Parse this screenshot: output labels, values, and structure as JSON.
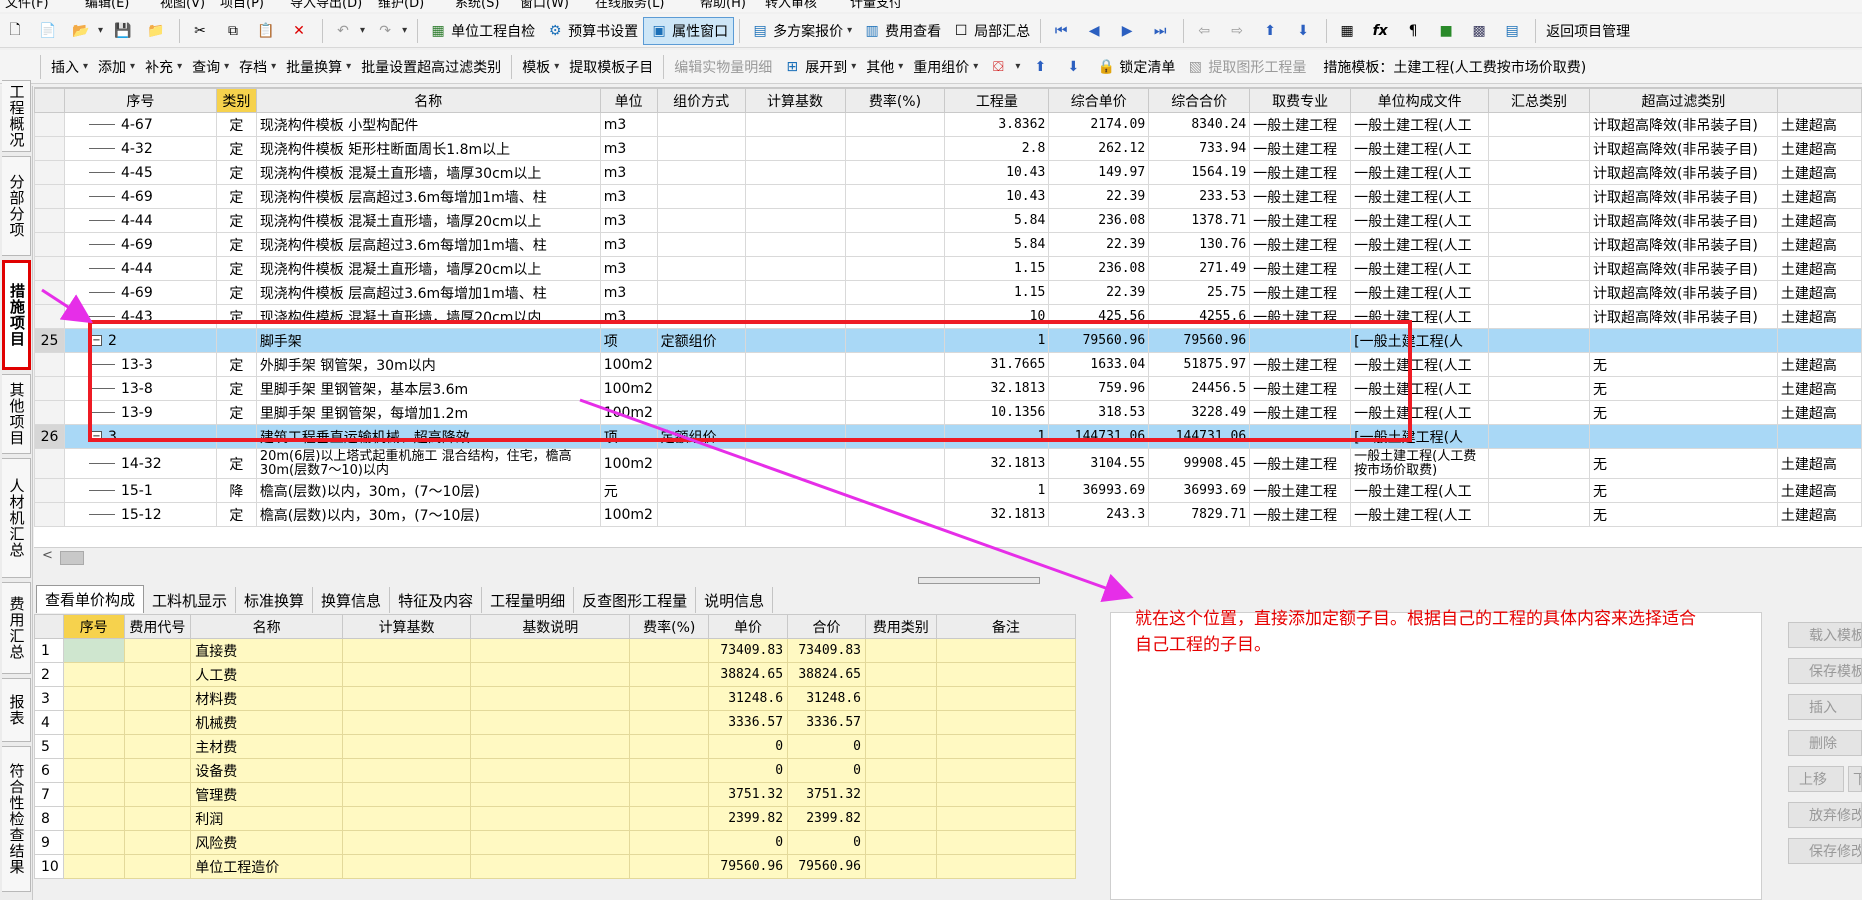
{
  "menu": {
    "items": [
      "文件(F)",
      "编辑(E)",
      "视图(V)",
      "项目(P)",
      "导入导出(D)",
      "维护(D)",
      "系统(S)",
      "窗口(W)",
      "在线服务(L)",
      "帮助(H)",
      "转入审核",
      "计量支付"
    ]
  },
  "toolbar1": {
    "unit_check": "单位工程自检",
    "budget_settings": "预算书设置",
    "property_window": "属性窗口",
    "multi_quote": "多方案报价",
    "fee_view": "费用查看",
    "partial_summary": "局部汇总",
    "return_project": "返回项目管理"
  },
  "toolbar2": {
    "insert": "插入",
    "add": "添加",
    "supplement": "补充",
    "query": "查询",
    "save_file": "存档",
    "batch_convert": "批量换算",
    "batch_filter": "批量设置超高过滤类别",
    "template": "模板",
    "extract_template": "提取模板子目",
    "edit_quantity": "编辑实物量明细",
    "expand": "展开到",
    "other": "其他",
    "reuse": "重用组价",
    "lock": "锁定清单",
    "extract_graphic": "提取图形工程量",
    "template_label": "措施模板：土建工程(人工费按市场价取费)"
  },
  "left_tabs": [
    "工程概况",
    "分部分项",
    "措施项目",
    "其他项目",
    "人材机汇总",
    "费用汇总",
    "报表",
    "符合性检查结果"
  ],
  "main_table": {
    "headers": [
      "",
      "序号",
      "类别",
      "名称",
      "单位",
      "组价方式",
      "计算基数",
      "费率(%)",
      "工程量",
      "综合单价",
      "综合合价",
      "取费专业",
      "单位构成文件",
      "汇总类别",
      "超高过滤类别",
      ""
    ],
    "rows": [
      {
        "rn": "",
        "code": "4-67",
        "type": "定",
        "name": "现浇构件模板 小型构配件",
        "unit": "m3",
        "method": "",
        "base": "",
        "rate": "",
        "qty": "3.8362",
        "price": "2174.09",
        "total": "8340.24",
        "spec": "一般土建工程",
        "file": "一般土建工程(人工",
        "sum": "",
        "filter": "计取超高降效(非吊装子目)",
        "extra": "土建超高"
      },
      {
        "rn": "",
        "code": "4-32",
        "type": "定",
        "name": "现浇构件模板 矩形柱断面周长1.8m以上",
        "unit": "m3",
        "method": "",
        "base": "",
        "rate": "",
        "qty": "2.8",
        "price": "262.12",
        "total": "733.94",
        "spec": "一般土建工程",
        "file": "一般土建工程(人工",
        "sum": "",
        "filter": "计取超高降效(非吊装子目)",
        "extra": "土建超高"
      },
      {
        "rn": "",
        "code": "4-45",
        "type": "定",
        "name": "现浇构件模板 混凝土直形墙，墙厚30cm以上",
        "unit": "m3",
        "method": "",
        "base": "",
        "rate": "",
        "qty": "10.43",
        "price": "149.97",
        "total": "1564.19",
        "spec": "一般土建工程",
        "file": "一般土建工程(人工",
        "sum": "",
        "filter": "计取超高降效(非吊装子目)",
        "extra": "土建超高"
      },
      {
        "rn": "",
        "code": "4-69",
        "type": "定",
        "name": "现浇构件模板 层高超过3.6m每增加1m墙、柱",
        "unit": "m3",
        "method": "",
        "base": "",
        "rate": "",
        "qty": "10.43",
        "price": "22.39",
        "total": "233.53",
        "spec": "一般土建工程",
        "file": "一般土建工程(人工",
        "sum": "",
        "filter": "计取超高降效(非吊装子目)",
        "extra": "土建超高"
      },
      {
        "rn": "",
        "code": "4-44",
        "type": "定",
        "name": "现浇构件模板 混凝土直形墙，墙厚20cm以上",
        "unit": "m3",
        "method": "",
        "base": "",
        "rate": "",
        "qty": "5.84",
        "price": "236.08",
        "total": "1378.71",
        "spec": "一般土建工程",
        "file": "一般土建工程(人工",
        "sum": "",
        "filter": "计取超高降效(非吊装子目)",
        "extra": "土建超高"
      },
      {
        "rn": "",
        "code": "4-69",
        "type": "定",
        "name": "现浇构件模板 层高超过3.6m每增加1m墙、柱",
        "unit": "m3",
        "method": "",
        "base": "",
        "rate": "",
        "qty": "5.84",
        "price": "22.39",
        "total": "130.76",
        "spec": "一般土建工程",
        "file": "一般土建工程(人工",
        "sum": "",
        "filter": "计取超高降效(非吊装子目)",
        "extra": "土建超高"
      },
      {
        "rn": "",
        "code": "4-44",
        "type": "定",
        "name": "现浇构件模板 混凝土直形墙，墙厚20cm以上",
        "unit": "m3",
        "method": "",
        "base": "",
        "rate": "",
        "qty": "1.15",
        "price": "236.08",
        "total": "271.49",
        "spec": "一般土建工程",
        "file": "一般土建工程(人工",
        "sum": "",
        "filter": "计取超高降效(非吊装子目)",
        "extra": "土建超高"
      },
      {
        "rn": "",
        "code": "4-69",
        "type": "定",
        "name": "现浇构件模板 层高超过3.6m每增加1m墙、柱",
        "unit": "m3",
        "method": "",
        "base": "",
        "rate": "",
        "qty": "1.15",
        "price": "22.39",
        "total": "25.75",
        "spec": "一般土建工程",
        "file": "一般土建工程(人工",
        "sum": "",
        "filter": "计取超高降效(非吊装子目)",
        "extra": "土建超高"
      },
      {
        "rn": "",
        "code": "4-43",
        "type": "定",
        "name": "现浇构件模板 混凝土直形墙，墙厚20cm以内",
        "unit": "m3",
        "method": "",
        "base": "",
        "rate": "",
        "qty": "10",
        "price": "425.56",
        "total": "4255.6",
        "spec": "一般土建工程",
        "file": "一般土建工程(人工",
        "sum": "",
        "filter": "计取超高降效(非吊装子目)",
        "extra": "土建超高"
      },
      {
        "rn": "25",
        "group": true,
        "code": "2",
        "type": "",
        "name": "脚手架",
        "unit": "项",
        "method": "定额组价",
        "base": "",
        "rate": "",
        "qty": "1",
        "price": "79560.96",
        "total": "79560.96",
        "spec": "",
        "file": "[一般土建工程(人",
        "sum": "",
        "filter": "",
        "extra": ""
      },
      {
        "rn": "",
        "code": "13-3",
        "type": "定",
        "name": "外脚手架 钢管架，30m以内",
        "unit": "100m2",
        "method": "",
        "base": "",
        "rate": "",
        "qty": "31.7665",
        "price": "1633.04",
        "total": "51875.97",
        "spec": "一般土建工程",
        "file": "一般土建工程(人工",
        "sum": "",
        "filter": "无",
        "extra": "土建超高"
      },
      {
        "rn": "",
        "code": "13-8",
        "type": "定",
        "name": "里脚手架 里钢管架，基本层3.6m",
        "unit": "100m2",
        "method": "",
        "base": "",
        "rate": "",
        "qty": "32.1813",
        "price": "759.96",
        "total": "24456.5",
        "spec": "一般土建工程",
        "file": "一般土建工程(人工",
        "sum": "",
        "filter": "无",
        "extra": "土建超高"
      },
      {
        "rn": "",
        "code": "13-9",
        "type": "定",
        "name": "里脚手架 里钢管架，每增加1.2m",
        "unit": "100m2",
        "method": "",
        "base": "",
        "rate": "",
        "qty": "10.1356",
        "price": "318.53",
        "total": "3228.49",
        "spec": "一般土建工程",
        "file": "一般土建工程(人工",
        "sum": "",
        "filter": "无",
        "extra": "土建超高"
      },
      {
        "rn": "26",
        "group": true,
        "code": "3",
        "type": "",
        "name": "建筑工程垂直运输机械、超高降效",
        "unit": "项",
        "method": "定额组价",
        "base": "",
        "rate": "",
        "qty": "1",
        "price": "144731.06",
        "total": "144731.06",
        "spec": "",
        "file": "[一般土建工程(人",
        "sum": "",
        "filter": "",
        "extra": ""
      },
      {
        "rn": "",
        "code": "14-32",
        "type": "定",
        "name": "20m(6层)以上塔式起重机施工 混合结构，住宅，檐高30m(层数7～10)以内",
        "unit": "100m2",
        "method": "",
        "base": "",
        "rate": "",
        "qty": "32.1813",
        "price": "3104.55",
        "total": "99908.45",
        "spec": "一般土建工程",
        "file": "一般土建工程(人工费按市场价取费)",
        "sum": "",
        "filter": "无",
        "extra": "土建超高",
        "tall": true
      },
      {
        "rn": "",
        "code": "15-1",
        "type": "降",
        "name": "檐高(层数)以内，30m，(7～10层)",
        "unit": "元",
        "method": "",
        "base": "",
        "rate": "",
        "qty": "1",
        "price": "36993.69",
        "total": "36993.69",
        "spec": "一般土建工程",
        "file": "一般土建工程(人工",
        "sum": "",
        "filter": "无",
        "extra": "土建超高"
      },
      {
        "rn": "",
        "code": "15-12",
        "type": "定",
        "name": "檐高(层数)以内，30m，(7～10层)",
        "unit": "100m2",
        "method": "",
        "base": "",
        "rate": "",
        "qty": "32.1813",
        "price": "243.3",
        "total": "7829.71",
        "spec": "一般土建工程",
        "file": "一般土建工程(人工",
        "sum": "",
        "filter": "无",
        "extra": "土建超高"
      }
    ]
  },
  "bottom_tabs": [
    "查看单价构成",
    "工料机显示",
    "标准换算",
    "换算信息",
    "特征及内容",
    "工程量明细",
    "反查图形工程量",
    "说明信息"
  ],
  "bottom_table": {
    "headers": [
      "",
      "序号",
      "费用代号",
      "名称",
      "计算基数",
      "基数说明",
      "费率(%)",
      "单价",
      "合价",
      "费用类别",
      "备注"
    ],
    "rows": [
      {
        "rn": "1",
        "name": "直接费",
        "price": "73409.83",
        "total": "73409.83"
      },
      {
        "rn": "2",
        "name": "人工费",
        "price": "38824.65",
        "total": "38824.65"
      },
      {
        "rn": "3",
        "name": "材料费",
        "price": "31248.6",
        "total": "31248.6"
      },
      {
        "rn": "4",
        "name": "机械费",
        "price": "3336.57",
        "total": "3336.57"
      },
      {
        "rn": "5",
        "name": "主材费",
        "price": "0",
        "total": "0"
      },
      {
        "rn": "6",
        "name": "设备费",
        "price": "0",
        "total": "0"
      },
      {
        "rn": "7",
        "name": "管理费",
        "price": "3751.32",
        "total": "3751.32"
      },
      {
        "rn": "8",
        "name": "利润",
        "price": "2399.82",
        "total": "2399.82"
      },
      {
        "rn": "9",
        "name": "风险费",
        "price": "0",
        "total": "0"
      },
      {
        "rn": "10",
        "name": "单位工程造价",
        "price": "79560.96",
        "total": "79560.96"
      }
    ]
  },
  "annotation": {
    "note": "就在这个位置，直接添加定额子目。根据自己的工程的具体内容来选择适合自己工程的子目。"
  },
  "right_buttons": [
    "载入模板",
    "保存模板",
    "插入",
    "删除",
    "上移",
    "下移",
    "放弃修改",
    "保存修改"
  ],
  "colors": {
    "highlight_header": "#f6d24d",
    "group_row": "#a9d8f6",
    "annotation": "#ee1b24",
    "arrow": "#e62ee8",
    "bottom_cells": "#fff9c2"
  }
}
